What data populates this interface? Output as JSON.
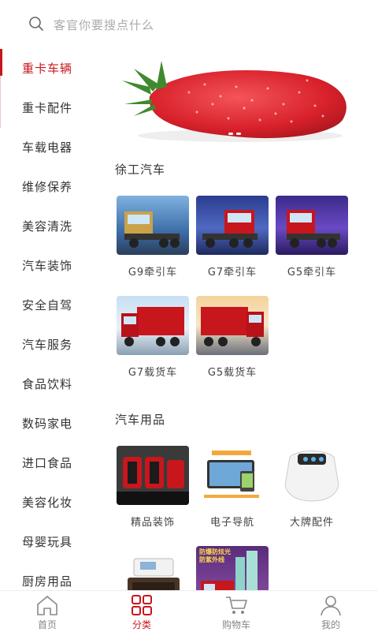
{
  "search": {
    "placeholder": "客官你要搜点什么",
    "icon": "search-icon"
  },
  "sidebar": {
    "items": [
      {
        "label": "重卡车辆",
        "active": true
      },
      {
        "label": "重卡配件"
      },
      {
        "label": "车载电器"
      },
      {
        "label": "维修保养"
      },
      {
        "label": "美容清洗"
      },
      {
        "label": "汽车装饰"
      },
      {
        "label": "安全自驾"
      },
      {
        "label": "汽车服务"
      },
      {
        "label": "食品饮料"
      },
      {
        "label": "数码家电"
      },
      {
        "label": "进口食品"
      },
      {
        "label": "美容化妆"
      },
      {
        "label": "母婴玩具"
      },
      {
        "label": "厨房用品"
      }
    ]
  },
  "sections": [
    {
      "title": "徐工汽车",
      "products": [
        {
          "label": "G9牵引车"
        },
        {
          "label": "G7牵引车"
        },
        {
          "label": "G5牵引车"
        },
        {
          "label": "G7载货车"
        },
        {
          "label": "G5载货车"
        }
      ]
    },
    {
      "title": "汽车用品",
      "products": [
        {
          "label": "精品装饰"
        },
        {
          "label": "电子导航"
        },
        {
          "label": "大牌配件"
        },
        {
          "label": ""
        },
        {
          "label": "",
          "image_text": "防爆防炫光 防紫外线"
        }
      ]
    }
  ],
  "tabbar": {
    "items": [
      {
        "label": "首页",
        "icon": "home-icon"
      },
      {
        "label": "分类",
        "icon": "category-icon",
        "active": true
      },
      {
        "label": "购物车",
        "icon": "cart-icon"
      },
      {
        "label": "我的",
        "icon": "user-icon"
      }
    ]
  },
  "colors": {
    "accent": "#c8161d",
    "text": "#333333",
    "muted": "#888888"
  }
}
